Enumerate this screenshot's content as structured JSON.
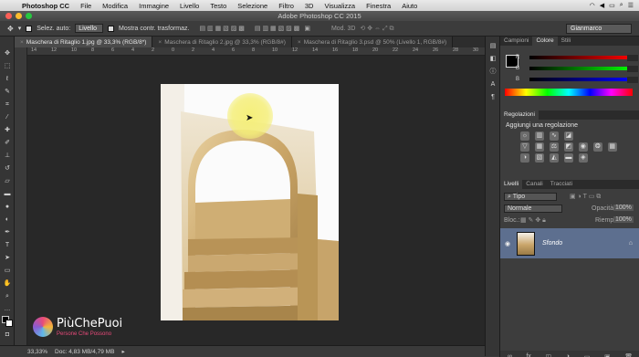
{
  "menubar": {
    "app": "Photoshop CC",
    "items": [
      "File",
      "Modifica",
      "Immagine",
      "Livello",
      "Testo",
      "Selezione",
      "Filtro",
      "3D",
      "Visualizza",
      "Finestra",
      "Aiuto"
    ]
  },
  "window": {
    "title": "Adobe Photoshop CC 2015"
  },
  "options_bar": {
    "auto_select_label": "Selez. auto:",
    "auto_select_value": "Livello",
    "transform_label": "Mostra contr. trasformaz.",
    "mode_3d_label": "Mod. 3D",
    "workspace": "Gianmarco"
  },
  "tabs": [
    {
      "label": "Maschera di Ritaglio 1.jpg @ 33,3% (RGB/8*)",
      "active": true
    },
    {
      "label": "Maschera di Ritaglio 2.jpg @ 33,3% (RGB/8#)",
      "active": false
    },
    {
      "label": "Maschera di Ritaglio 3.psd @ 50% (Livello 1, RGB/8#)",
      "active": false
    }
  ],
  "ruler_h": [
    "14",
    "12",
    "10",
    "8",
    "6",
    "4",
    "2",
    "0",
    "2",
    "4",
    "6",
    "8",
    "10",
    "12",
    "14",
    "16",
    "18",
    "20",
    "22",
    "24",
    "26",
    "28",
    "30",
    "32"
  ],
  "color_panel": {
    "tabs": [
      "Campioni",
      "Colore",
      "Stili"
    ],
    "active_tab": "Colore",
    "sliders": [
      {
        "label": "R",
        "gradient": [
          "#000000",
          "#ff0000"
        ]
      },
      {
        "label": "G",
        "gradient": [
          "#000000",
          "#00ff00"
        ]
      },
      {
        "label": "B",
        "gradient": [
          "#000000",
          "#0000ff"
        ]
      }
    ]
  },
  "adjustments_panel": {
    "tab": "Regolazioni",
    "heading": "Aggiungi una regolazione",
    "icons": [
      "brightness-icon",
      "levels-icon",
      "curves-icon",
      "exposure-icon",
      "vibrance-icon",
      "hue-icon",
      "balance-icon",
      "bw-icon",
      "photo-filter-icon",
      "channel-mixer-icon",
      "lookup-icon",
      "invert-icon",
      "posterize-icon",
      "threshold-icon",
      "gradient-map-icon",
      "selective-color-icon"
    ]
  },
  "layers_panel": {
    "tabs": [
      "Livelli",
      "Canali",
      "Tracciati"
    ],
    "active_tab": "Livelli",
    "filter": "Tipo",
    "blend_mode": "Normale",
    "opacity_label": "Opacità:",
    "opacity_value": "100%",
    "lock_label": "Bloc.:",
    "fill_label": "Riemp.:",
    "fill_value": "100%",
    "layers": [
      {
        "name": "Sfondo",
        "visible": true,
        "locked": true
      }
    ]
  },
  "status_bar": {
    "zoom": "33,33%",
    "doc": "Doc: 4,83 MB/4,79 MB"
  },
  "logo": {
    "name": "PiùChePuoi",
    "tagline": "Persone Che Possono"
  },
  "colors": {
    "highlight": "#f5ef7a",
    "selected_layer": "#5d6f8f"
  }
}
